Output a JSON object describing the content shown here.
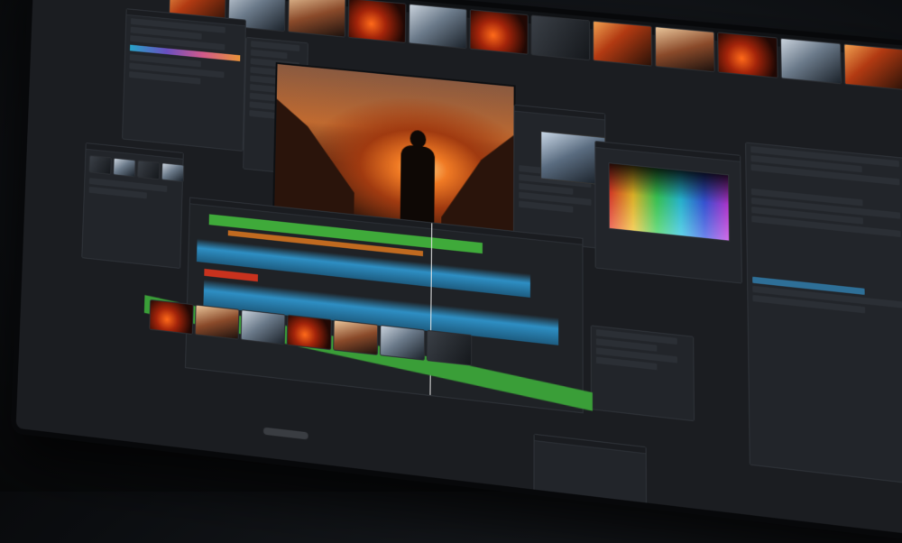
{
  "app": {
    "title": ""
  },
  "colors": {
    "accent": "#2e8fc4",
    "clip_green": "#3faa3a",
    "clip_red": "#c8321e",
    "warm": "#f07a24"
  },
  "left_panel": {
    "title": "",
    "gradient_label": ""
  },
  "media_panel": {
    "title": ""
  },
  "inspector": {
    "title": ""
  },
  "scope": {
    "title": ""
  },
  "right_panel": {
    "items": []
  },
  "timeline": {
    "title": ""
  },
  "bottom_panel": {
    "title": ""
  }
}
